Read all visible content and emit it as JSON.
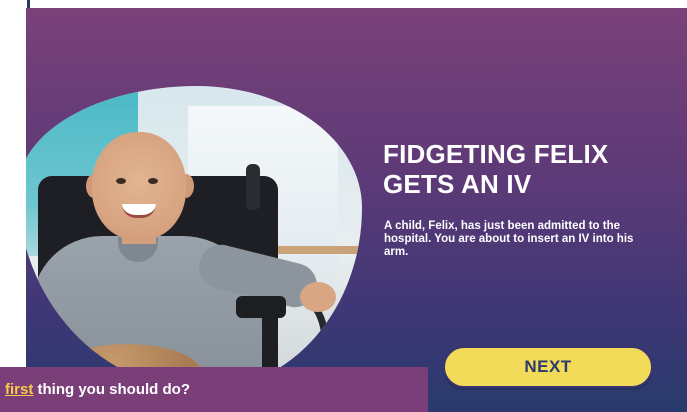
{
  "slide": {
    "title": "FIDGETING FELIX GETS AN IV",
    "description": "A child, Felix, has just been admitted to the hospital. You are about to insert an IV into his arm.",
    "next_label": "NEXT",
    "photo_icon": "child-in-wheelchair-photo"
  },
  "question": {
    "highlight": "first",
    "rest": " thing you should do?"
  },
  "colors": {
    "card_top": "#7a4179",
    "card_bottom": "#283a6c",
    "button": "#f2db58",
    "button_text": "#2c3a6e",
    "question_bar": "#7a3f78",
    "highlight": "#f7c94c"
  }
}
